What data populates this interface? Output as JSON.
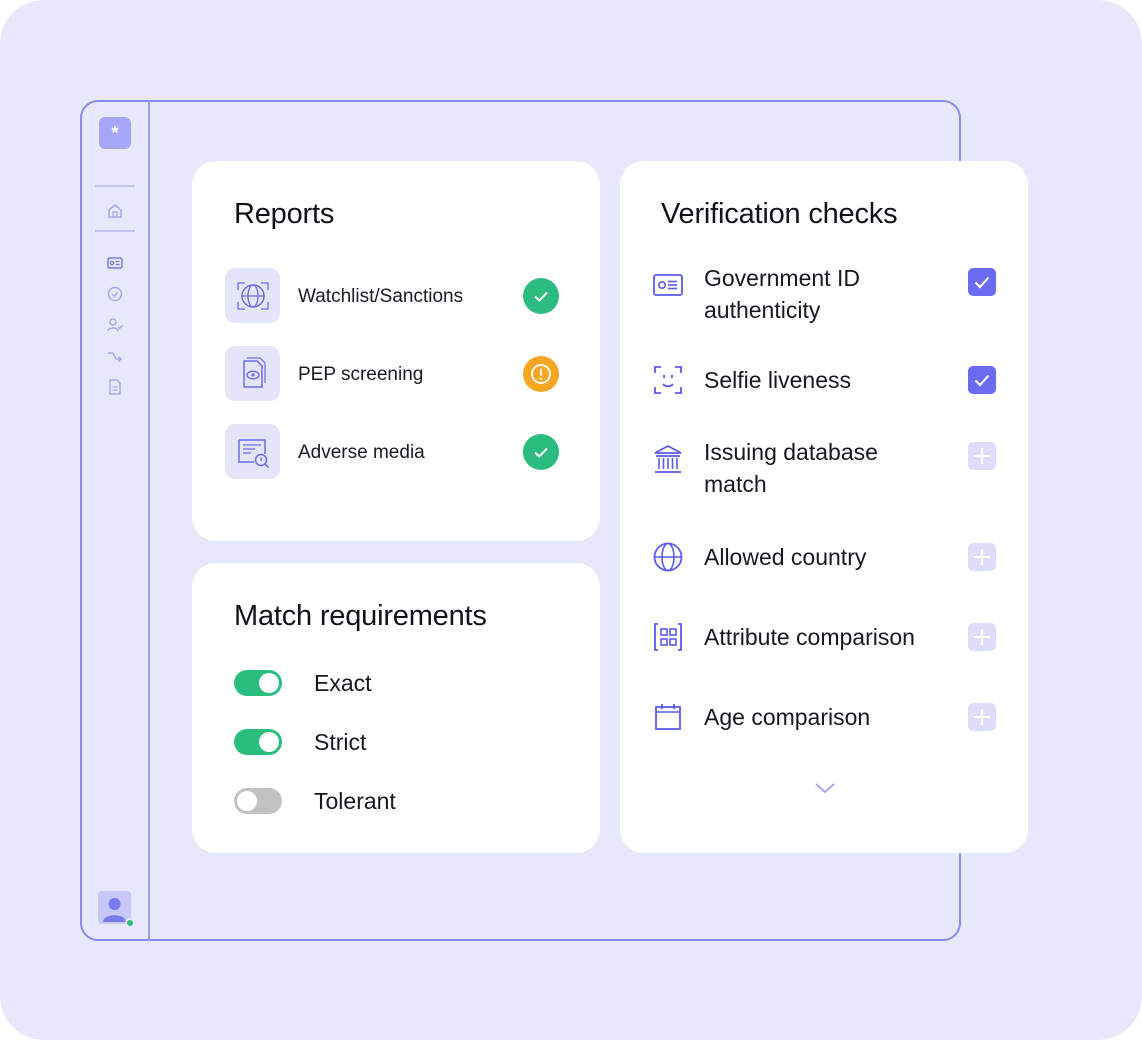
{
  "colors": {
    "background": "#e8e8fd",
    "accent": "#6b6bf2",
    "success": "#2bbd7e",
    "warning": "#f5a623",
    "toggle_off": "#c2c2c2"
  },
  "sidebar": {
    "logo_glyph": "*",
    "items": [
      {
        "icon": "home-icon"
      },
      {
        "icon": "id-card-icon"
      },
      {
        "icon": "check-circle-icon"
      },
      {
        "icon": "user-check-icon"
      },
      {
        "icon": "workflow-arrow-icon"
      },
      {
        "icon": "document-icon"
      }
    ],
    "avatar_status": "online"
  },
  "reports": {
    "title": "Reports",
    "items": [
      {
        "label": "Watchlist/Sanctions",
        "icon": "globe-target-icon",
        "status": "passed"
      },
      {
        "label": "PEP screening",
        "icon": "document-eye-icon",
        "status": "warning"
      },
      {
        "label": "Adverse media",
        "icon": "news-search-icon",
        "status": "passed"
      }
    ]
  },
  "match_requirements": {
    "title": "Match requirements",
    "options": [
      {
        "label": "Exact",
        "enabled": true
      },
      {
        "label": "Strict",
        "enabled": true
      },
      {
        "label": "Tolerant",
        "enabled": false
      }
    ]
  },
  "verification_checks": {
    "title": "Verification checks",
    "items": [
      {
        "label_line1": "Government ID",
        "label_line2": "authenticity",
        "icon": "id-card-icon",
        "checked": true
      },
      {
        "label_line1": "Selfie liveness",
        "label_line2": "",
        "icon": "face-scan-icon",
        "checked": true
      },
      {
        "label_line1": "Issuing database",
        "label_line2": "match",
        "icon": "bank-building-icon",
        "checked": false
      },
      {
        "label_line1": "Allowed country",
        "label_line2": "",
        "icon": "globe-icon",
        "checked": false
      },
      {
        "label_line1": "Attribute comparison",
        "label_line2": "",
        "icon": "grid-scan-icon",
        "checked": false
      },
      {
        "label_line1": "Age comparison",
        "label_line2": "",
        "icon": "calendar-icon",
        "checked": false
      }
    ],
    "more_icon": "chevron-down-icon"
  }
}
